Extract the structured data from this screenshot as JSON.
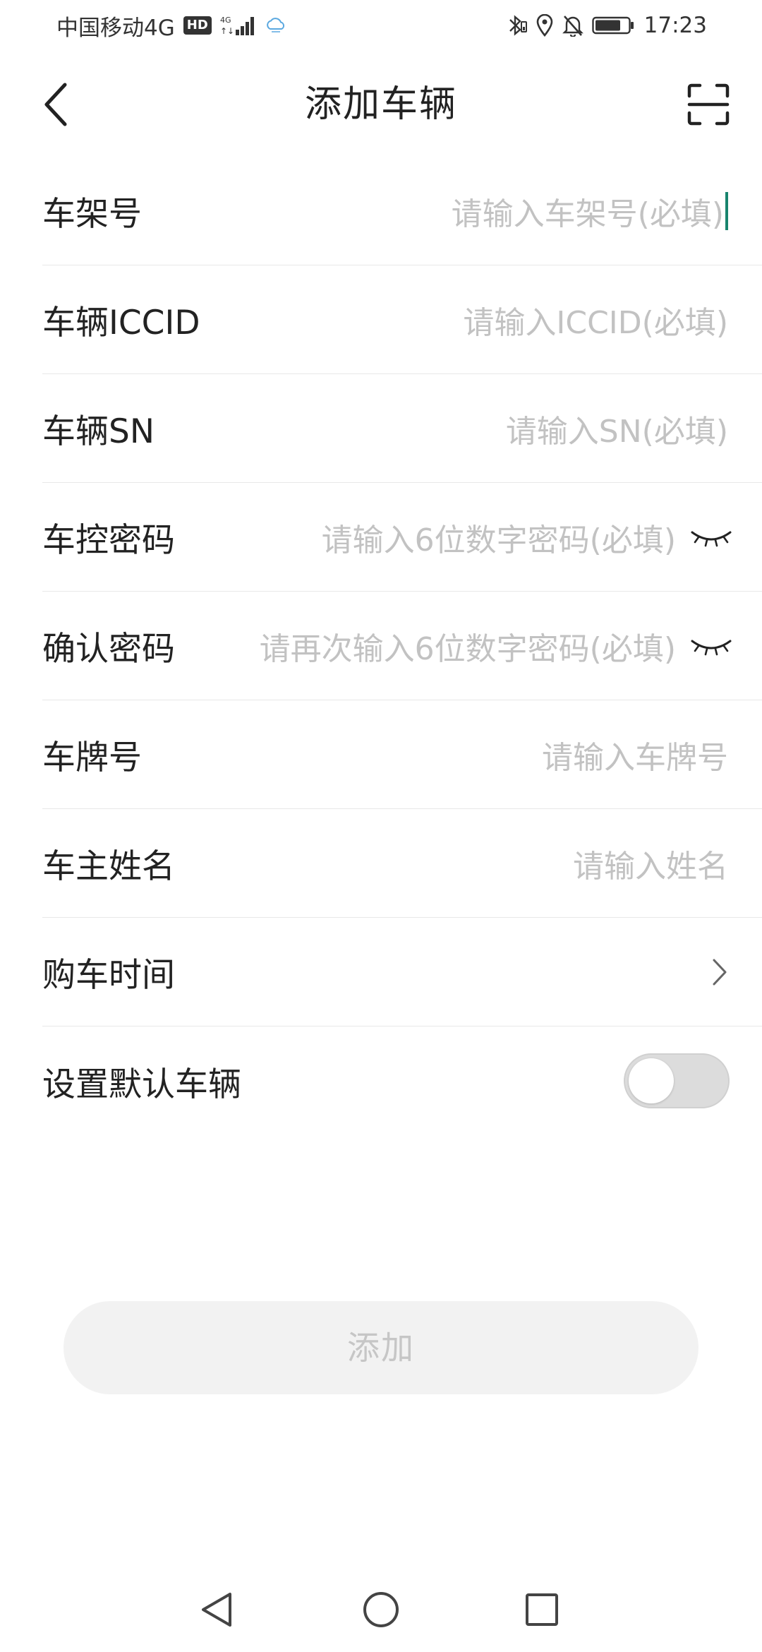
{
  "status_bar": {
    "carrier": "中国移动4G",
    "hd_badge": "HD",
    "signal_label": "4G",
    "time": "17:23",
    "icons": [
      "hd-icon",
      "signal-icon",
      "cloud-icon",
      "bluetooth-icon",
      "location-icon",
      "mute-icon",
      "battery-icon"
    ]
  },
  "header": {
    "title": "添加车辆",
    "back_icon": "chevron-left-icon",
    "scan_icon": "scan-icon"
  },
  "form": {
    "fields": [
      {
        "label": "车架号",
        "placeholder": "请输入车架号(必填)"
      },
      {
        "label": "车辆ICCID",
        "placeholder": "请输入ICCID(必填)"
      },
      {
        "label": "车辆SN",
        "placeholder": "请输入SN(必填)"
      },
      {
        "label": "车控密码",
        "placeholder": "请输入6位数字密码(必填)"
      },
      {
        "label": "确认密码",
        "placeholder": "请再次输入6位数字密码(必填)"
      },
      {
        "label": "车牌号",
        "placeholder": "请输入车牌号"
      },
      {
        "label": "车主姓名",
        "placeholder": "请输入姓名"
      },
      {
        "label": "购车时间"
      },
      {
        "label": "设置默认车辆"
      }
    ],
    "default_vehicle_enabled": false,
    "accent_color": "#18846e"
  },
  "submit": {
    "label": "添加"
  },
  "nav_bar": {
    "icons": [
      "nav-back-icon",
      "nav-home-icon",
      "nav-recent-icon"
    ]
  }
}
